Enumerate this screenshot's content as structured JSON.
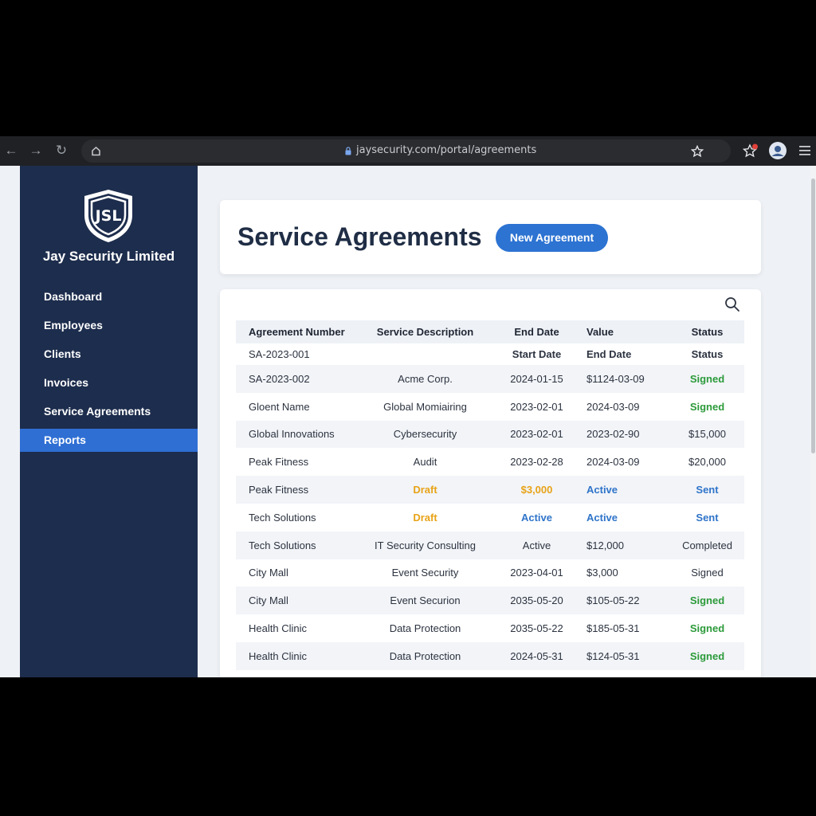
{
  "browser": {
    "url": "jaysecurity.com/portal/agreements"
  },
  "sidebar": {
    "logo_text": "JSL",
    "company_name": "Jay Security Limited",
    "items": [
      {
        "label": "Dashboard",
        "active": false
      },
      {
        "label": "Employees",
        "active": false
      },
      {
        "label": "Clients",
        "active": false
      },
      {
        "label": "Invoices",
        "active": false
      },
      {
        "label": "Service Agreements",
        "active": false
      },
      {
        "label": "Reports",
        "active": true
      }
    ]
  },
  "header": {
    "title": "Service Agreements",
    "new_button": "New Agreement"
  },
  "table": {
    "columns": [
      "Agreement Number",
      "Service Description",
      "End Date",
      "Value",
      "Status"
    ],
    "subheader": [
      "SA-2023-001",
      "",
      "Start Date",
      "End Date",
      "Status"
    ],
    "rows": [
      {
        "cells": [
          "SA-2023-002",
          "Acme Corp.",
          "2024-01-15",
          "$1124-03-09",
          "Signed"
        ],
        "styles": [
          "",
          "",
          "",
          "",
          "green"
        ]
      },
      {
        "cells": [
          "Gloent Name",
          "Global Momiairing",
          "2023-02-01",
          "2024-03-09",
          "Signed"
        ],
        "styles": [
          "",
          "",
          "",
          "",
          "green"
        ]
      },
      {
        "cells": [
          "Global Innovations",
          "Cybersecurity",
          "2023-02-01",
          "2023-02-90",
          "$15,000"
        ],
        "styles": [
          "",
          "",
          "",
          "",
          ""
        ]
      },
      {
        "cells": [
          "Peak Fitness",
          "Audit",
          "2023-02-28",
          "2024-03-09",
          "$20,000"
        ],
        "styles": [
          "",
          "",
          "",
          "",
          ""
        ]
      },
      {
        "cells": [
          "Peak Fitness",
          "Draft",
          "$3,000",
          "Active",
          "Sent"
        ],
        "styles": [
          "",
          "orange",
          "orange",
          "blue",
          "blue"
        ]
      },
      {
        "cells": [
          "Tech Solutions",
          "Draft",
          "Active",
          "Active",
          "Sent"
        ],
        "styles": [
          "",
          "orange",
          "blue",
          "blue",
          "blue"
        ]
      },
      {
        "cells": [
          "Tech Solutions",
          "IT Security Consulting",
          "Active",
          "$12,000",
          "Completed"
        ],
        "styles": [
          "",
          "",
          "",
          "",
          ""
        ]
      },
      {
        "cells": [
          "City Mall",
          "Event Security",
          "2023-04-01",
          "$3,000",
          "Signed"
        ],
        "styles": [
          "",
          "",
          "",
          "",
          ""
        ]
      },
      {
        "cells": [
          "City Mall",
          "Event Securion",
          "2035-05-20",
          "$105-05-22",
          "Signed"
        ],
        "styles": [
          "",
          "",
          "",
          "",
          "green"
        ]
      },
      {
        "cells": [
          "Health Clinic",
          "Data Protection",
          "2035-05-22",
          "$185-05-31",
          "Signed"
        ],
        "styles": [
          "",
          "",
          "",
          "",
          "green"
        ]
      },
      {
        "cells": [
          "Health Clinic",
          "Data Protection",
          "2024-05-31",
          "$124-05-31",
          "Signed"
        ],
        "styles": [
          "",
          "",
          "",
          "",
          "green"
        ]
      }
    ]
  },
  "colors": {
    "sidebar_bg": "#1d2d4d",
    "accent": "#2f6fd4",
    "status_green": "#2c9a3a",
    "status_orange": "#e8a317",
    "status_blue": "#2f74c9"
  },
  "icons": [
    "back-icon",
    "forward-icon",
    "reload-icon",
    "home-icon",
    "lock-icon",
    "star-icon",
    "extensions-icon",
    "profile-icon",
    "menu-icon",
    "search-icon",
    "shield-logo-icon"
  ]
}
